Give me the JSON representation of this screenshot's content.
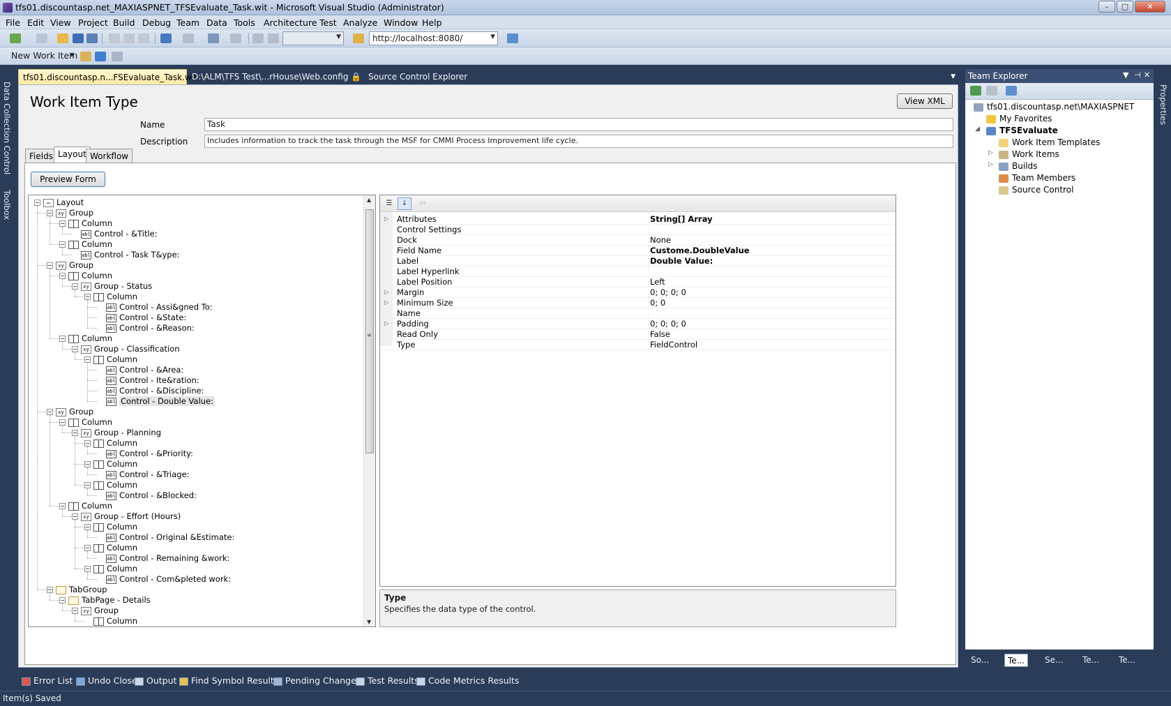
{
  "window": {
    "title": "tfs01.discountasp.net_MAXIASPNET_TFSEvaluate_Task.wit - Microsoft Visual Studio (Administrator)",
    "min_label": "–",
    "max_label": "□",
    "close_label": "✕"
  },
  "menu": [
    "File",
    "Edit",
    "View",
    "Project",
    "Build",
    "Debug",
    "Team",
    "Data",
    "Tools",
    "Architecture",
    "Test",
    "Analyze",
    "Window",
    "Help"
  ],
  "toolbar": {
    "url": "http://localhost:8080/",
    "new_work_item": "New Work Item"
  },
  "left_strip": {
    "data_collection": "Data Collection Control",
    "toolbox": "Toolbox"
  },
  "right_strip": {
    "properties": "Properties"
  },
  "doc_tabs": [
    {
      "label": "tfs01.discountasp.n...FSEvaluate_Task.wit",
      "active": true
    },
    {
      "label": "D:\\ALM\\TFS Test\\...rHouse\\Web.config",
      "active": false
    },
    {
      "label": "Source Control Explorer",
      "active": false
    }
  ],
  "editor": {
    "heading": "Work Item Type",
    "view_xml": "View XML",
    "name_label": "Name",
    "name_value": "Task",
    "description_label": "Description",
    "description_value": "Includes information to track the task through the MSF for CMMI Process Improvement life cycle.",
    "tabs": [
      "Fields",
      "Layout",
      "Workflow"
    ],
    "active_tab": "Layout",
    "preview_form": "Preview Form"
  },
  "tree": {
    "nodes": [
      {
        "level": 0,
        "text": "Layout",
        "type": "root"
      },
      {
        "level": 1,
        "text": "Group",
        "type": "group"
      },
      {
        "level": 2,
        "text": "Column",
        "type": "column"
      },
      {
        "level": 3,
        "text": "Control - &Title:",
        "type": "control"
      },
      {
        "level": 2,
        "text": "Column",
        "type": "column"
      },
      {
        "level": 3,
        "text": "Control - Task T&ype:",
        "type": "control"
      },
      {
        "level": 1,
        "text": "Group",
        "type": "group"
      },
      {
        "level": 2,
        "text": "Column",
        "type": "column"
      },
      {
        "level": 3,
        "text": "Group - Status",
        "type": "group"
      },
      {
        "level": 4,
        "text": "Column",
        "type": "column"
      },
      {
        "level": 5,
        "text": "Control - Assi&gned To:",
        "type": "control"
      },
      {
        "level": 5,
        "text": "Control - &State:",
        "type": "control"
      },
      {
        "level": 5,
        "text": "Control - &Reason:",
        "type": "control"
      },
      {
        "level": 2,
        "text": "Column",
        "type": "column"
      },
      {
        "level": 3,
        "text": "Group - Classification",
        "type": "group"
      },
      {
        "level": 4,
        "text": "Column",
        "type": "column"
      },
      {
        "level": 5,
        "text": "Control - &Area:",
        "type": "control"
      },
      {
        "level": 5,
        "text": "Control - Ite&ration:",
        "type": "control"
      },
      {
        "level": 5,
        "text": "Control - &Discipline:",
        "type": "control"
      },
      {
        "level": 5,
        "text": "Control - Double Value:",
        "type": "control",
        "selected": true
      },
      {
        "level": 1,
        "text": "Group",
        "type": "group"
      },
      {
        "level": 2,
        "text": "Column",
        "type": "column"
      },
      {
        "level": 3,
        "text": "Group - Planning",
        "type": "group"
      },
      {
        "level": 4,
        "text": "Column",
        "type": "column"
      },
      {
        "level": 5,
        "text": "Control - &Priority:",
        "type": "control"
      },
      {
        "level": 4,
        "text": "Column",
        "type": "column"
      },
      {
        "level": 5,
        "text": "Control - &Triage:",
        "type": "control"
      },
      {
        "level": 4,
        "text": "Column",
        "type": "column"
      },
      {
        "level": 5,
        "text": "Control - &Blocked:",
        "type": "control"
      },
      {
        "level": 2,
        "text": "Column",
        "type": "column"
      },
      {
        "level": 3,
        "text": "Group - Effort (Hours)",
        "type": "group"
      },
      {
        "level": 4,
        "text": "Column",
        "type": "column"
      },
      {
        "level": 5,
        "text": "Control - Original &Estimate:",
        "type": "control"
      },
      {
        "level": 4,
        "text": "Column",
        "type": "column"
      },
      {
        "level": 5,
        "text": "Control - Remaining &work:",
        "type": "control"
      },
      {
        "level": 4,
        "text": "Column",
        "type": "column"
      },
      {
        "level": 5,
        "text": "Control - Com&pleted work:",
        "type": "control"
      },
      {
        "level": 1,
        "text": "TabGroup",
        "type": "tabgroup"
      },
      {
        "level": 2,
        "text": "TabPage - Details",
        "type": "tabgroup"
      },
      {
        "level": 3,
        "text": "Group",
        "type": "group"
      },
      {
        "level": 4,
        "text": "Column",
        "type": "column"
      }
    ]
  },
  "properties": {
    "rows": [
      {
        "name": "Attributes",
        "value": "String[] Array",
        "bold": true,
        "expandable": true
      },
      {
        "name": "Control Settings",
        "value": "",
        "bold": false,
        "expandable": false
      },
      {
        "name": "Dock",
        "value": "None",
        "bold": false,
        "expandable": false
      },
      {
        "name": "Field Name",
        "value": "Custome.DoubleValue",
        "bold": true,
        "expandable": false
      },
      {
        "name": "Label",
        "value": "Double Value:",
        "bold": true,
        "expandable": false
      },
      {
        "name": "Label Hyperlink",
        "value": "",
        "bold": false,
        "expandable": false
      },
      {
        "name": "Label Position",
        "value": "Left",
        "bold": false,
        "expandable": false
      },
      {
        "name": "Margin",
        "value": "0; 0; 0; 0",
        "bold": false,
        "expandable": true
      },
      {
        "name": "Minimum Size",
        "value": "0; 0",
        "bold": false,
        "expandable": true
      },
      {
        "name": "Name",
        "value": "",
        "bold": false,
        "expandable": false
      },
      {
        "name": "Padding",
        "value": "0; 0; 0; 0",
        "bold": false,
        "expandable": true
      },
      {
        "name": "Read Only",
        "value": "False",
        "bold": false,
        "expandable": false
      },
      {
        "name": "Type",
        "value": "FieldControl",
        "bold": false,
        "expandable": false
      }
    ],
    "desc_title": "Type",
    "desc_text": "Specifies the data type of the control."
  },
  "team_explorer": {
    "title": "Team Explorer",
    "server": "tfs01.discountasp.net\\MAXIASPNET",
    "my_favorites": "My Favorites",
    "project": "TFSEvaluate",
    "items": [
      "Work Item Templates",
      "Work Items",
      "Builds",
      "Team Members",
      "Source Control"
    ],
    "bottom_tabs": [
      "So...",
      "Te...",
      "Se...",
      "Te...",
      "Te..."
    ]
  },
  "bottom_tabs": [
    "Error List",
    "Undo Close",
    "Output",
    "Find Symbol Results",
    "Pending Changes",
    "Test Results",
    "Code Metrics Results"
  ],
  "status": "Item(s) Saved",
  "colors": {
    "chrome": "#2b3c59",
    "active_tab": "#fde9a4",
    "accent": "#3c5073"
  }
}
